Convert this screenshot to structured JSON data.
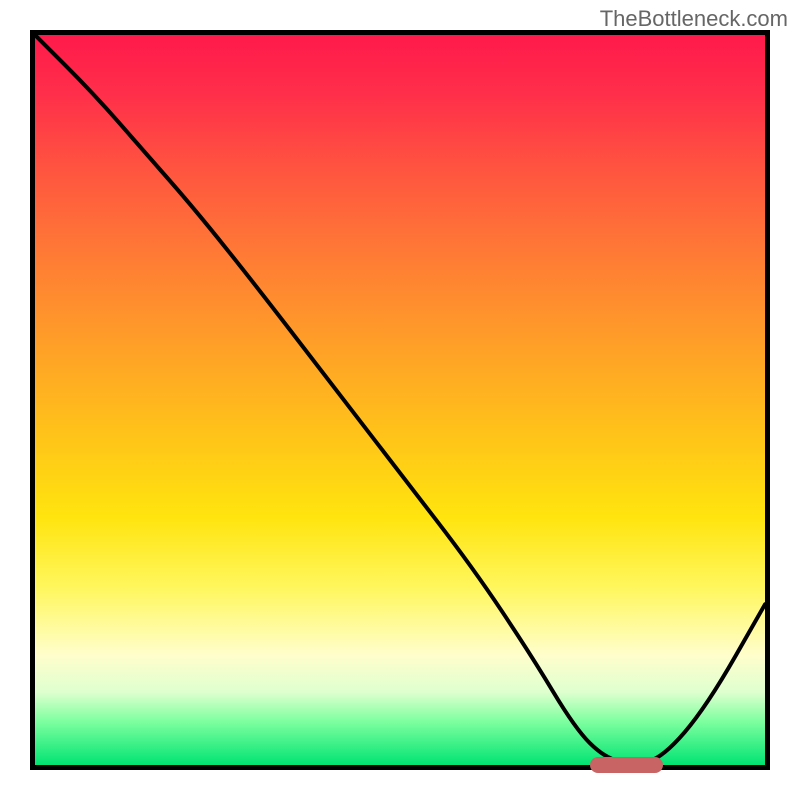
{
  "attribution": "TheBottleneck.com",
  "chart_data": {
    "type": "line",
    "title": "",
    "xlabel": "",
    "ylabel": "",
    "xlim": [
      0,
      100
    ],
    "ylim": [
      0,
      100
    ],
    "grid": false,
    "series": [
      {
        "name": "bottleneck-curve",
        "x": [
          0,
          8,
          15,
          22,
          30,
          40,
          50,
          60,
          68,
          74,
          78,
          82,
          86,
          92,
          100
        ],
        "values": [
          100,
          92,
          84,
          76,
          66,
          53,
          40,
          27,
          15,
          5,
          1,
          0,
          1,
          8,
          22
        ]
      }
    ],
    "optimum_band": {
      "x_start": 76,
      "x_end": 86
    },
    "gradient_stops": [
      {
        "pct": 0,
        "color": "#ff1a4b"
      },
      {
        "pct": 50,
        "color": "#ffc11a"
      },
      {
        "pct": 85,
        "color": "#fffecc"
      },
      {
        "pct": 100,
        "color": "#00e472"
      }
    ]
  }
}
